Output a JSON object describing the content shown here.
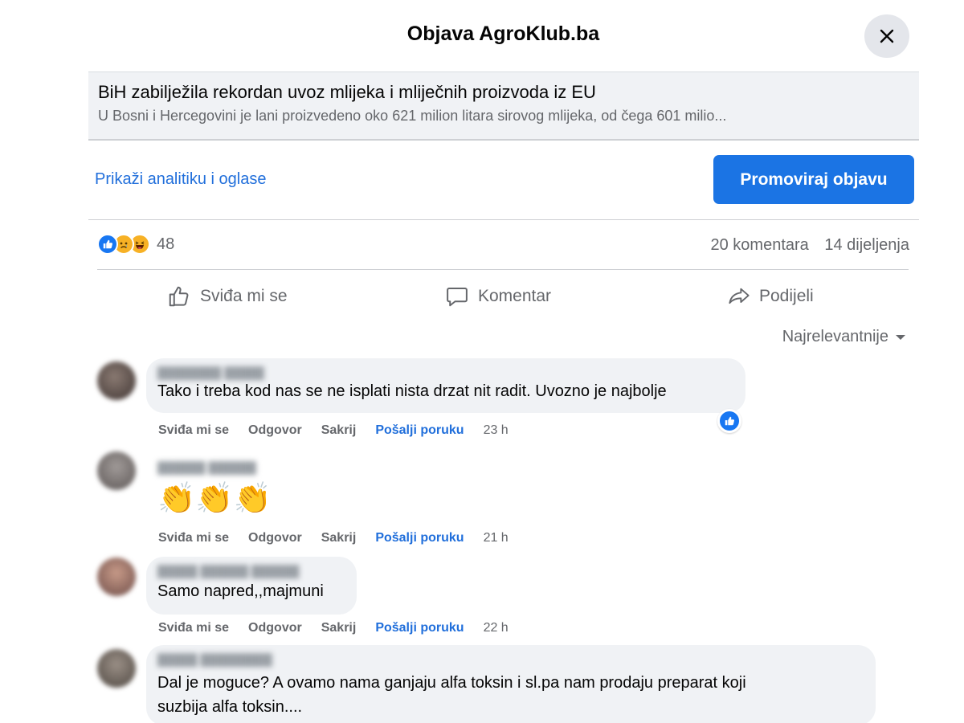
{
  "dialog": {
    "title": "Objava AgroKlub.ba",
    "close_icon": "close-icon"
  },
  "link_preview": {
    "title": "BiH zabilježila rekordan uvoz mlijeka i mliječnih proizvoda iz EU",
    "description": "U Bosni i Hercegovini je lani proizvedeno oko 621 milion litara sirovog mlijeka, od čega 601 milio..."
  },
  "toolbar": {
    "analytics_label": "Prikaži analitiku i oglase",
    "promote_label": "Promoviraj objavu"
  },
  "stats": {
    "reaction_icons": [
      "like-icon",
      "sad-icon",
      "haha-icon"
    ],
    "reaction_count": "48",
    "comments": "20 komentara",
    "shares": "14 dijeljenja"
  },
  "actions": {
    "like": "Sviđa mi se",
    "comment": "Komentar",
    "share": "Podijeli"
  },
  "sort": {
    "label": "Najrelevantnije"
  },
  "comments": [
    {
      "text": "Tako i treba kod nas se ne isplati nista drzat nit radit. Uvozno je najbolje",
      "like": "Sviđa mi se",
      "reply": "Odgovor",
      "hide": "Sakrij",
      "message": "Pošalji poruku",
      "time": "23 h"
    },
    {
      "emoji": "👏👏👏",
      "like": "Sviđa mi se",
      "reply": "Odgovor",
      "hide": "Sakrij",
      "message": "Pošalji poruku",
      "time": "21 h"
    },
    {
      "text": "Samo napred,,majmuni",
      "like": "Sviđa mi se",
      "reply": "Odgovor",
      "hide": "Sakrij",
      "message": "Pošalji poruku",
      "time": "22 h"
    },
    {
      "text_line1": "Dal je moguce? A ovamo nama ganjaju alfa toksin i sl.pa nam prodaju preparat koji",
      "text_line2": "suzbija alfa toksin...."
    }
  ],
  "colors": {
    "accent": "#1b74e4",
    "link": "#216fdb",
    "bubble": "#f0f2f5",
    "muted": "#65676b"
  }
}
